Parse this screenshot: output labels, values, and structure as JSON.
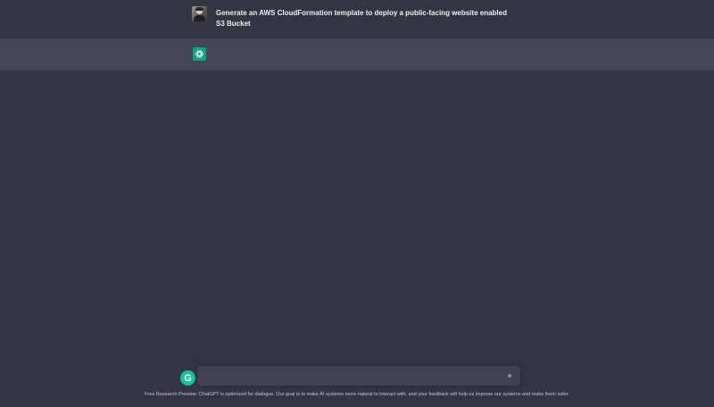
{
  "conversation": {
    "user_message": "Generate an AWS CloudFormation template to deploy a public-facing website enabled S3 Bucket",
    "assistant_message": ""
  },
  "composer": {
    "placeholder": "",
    "value": ""
  },
  "grammarly": {
    "glyph": "G"
  },
  "footer": {
    "text": "Free Research Preview: ChatGPT is optimized for dialogue. Our goal is to make AI systems more natural to interact with, and your feedback will help us improve our systems and make them safer."
  },
  "colors": {
    "background": "#343541",
    "assistant_row": "#444654",
    "gpt_avatar": "#10a37f",
    "composer": "#40414f",
    "grammarly": "#15c39a"
  },
  "icons": [
    "user-avatar",
    "chatgpt-logo-icon",
    "grammarly-icon",
    "send-icon"
  ]
}
